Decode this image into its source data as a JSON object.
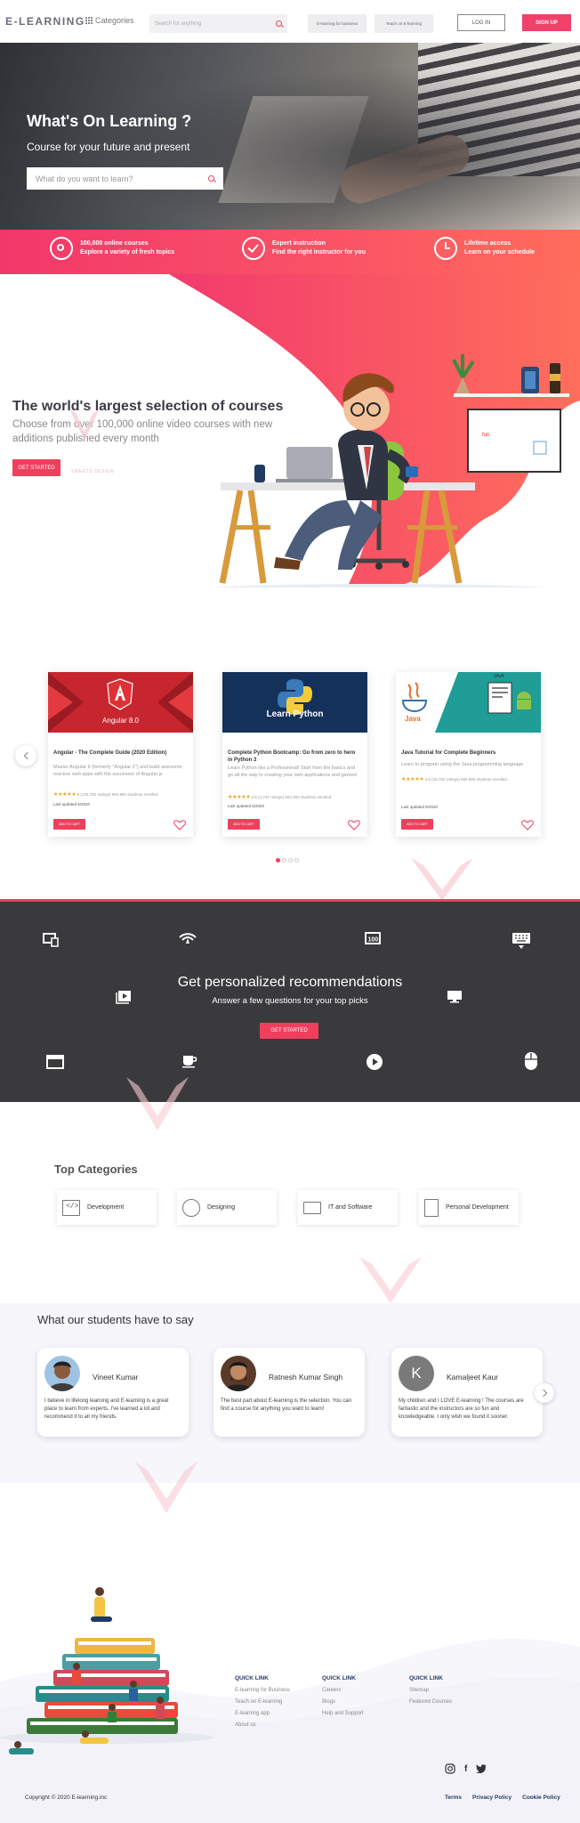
{
  "header": {
    "logo": "E-LEARNING",
    "categories": "Categories",
    "search_placeholder": "Search for anything",
    "pill_business": "E-learning for business",
    "pill_teach": "Teach on E-learning",
    "login": "LOG IN",
    "signup": "SIGN UP"
  },
  "hero": {
    "title": "What's On Learning ?",
    "subtitle": "Course for your future and present",
    "search_placeholder": "What do you want to learn?"
  },
  "features": [
    {
      "title": "100,000 online courses",
      "sub": "Explore a variety of fresh topics",
      "icon": "target-icon"
    },
    {
      "title": "Expert instruction",
      "sub": "Find the right instructor for you",
      "icon": "check-circle-icon"
    },
    {
      "title": "Lifetime access",
      "sub": "Learn on your schedule",
      "icon": "history-icon"
    }
  ],
  "selection": {
    "title": "The world's largest selection of courses",
    "subtitle": "Choose from over 100,000 online video courses with new additions published every month",
    "button": "GET STARTED",
    "watermark": "SWEETS DESIGN"
  },
  "courses": [
    {
      "thumb_label": "Angular 8.0",
      "title": "Angular - The Complete Guide (2020 Edition)",
      "desc": "Master Angular 9 (formerly \"Angular 2\") and build awesome, reactive web apps with the successor of Angular.js",
      "rating": "★★★★★",
      "rating_text": "5 (175,782 ratings) 584,950 students enrolled",
      "updated": "Last updated 5/2020",
      "button": "ADD TO CART"
    },
    {
      "thumb_label": "Learn Python",
      "title": "Complete Python Bootcamp: Go from zero to hero in Python 3",
      "desc": "Learn Python like a Professional! Start from the basics and go all the way to creating your own applications and games!",
      "rating": "★★★★★",
      "rating_text": "4.5 (4,742 ratings) 584,950 students enrolled",
      "updated": "Last updated 5/2020",
      "button": "ADD TO CART"
    },
    {
      "thumb_label": "Java",
      "thumb_label2": "JAVA",
      "title": "Java Tutorial for Complete Beginners",
      "desc": "Learn to program using the Java programming language",
      "rating": "★★★★★",
      "rating_text": "4.5 (18,782 ratings) 584,950 students enrolled",
      "updated": "Last updated 5/2020",
      "button": "ADD TO CART"
    }
  ],
  "recommend": {
    "title": "Get personalized recommendations",
    "subtitle": "Answer a few questions for your top picks",
    "button": "GET STARTED"
  },
  "top_categories": {
    "title": "Top Categories",
    "items": [
      {
        "label": "Development",
        "icon": "code-icon"
      },
      {
        "label": "Designing",
        "icon": "palette-icon"
      },
      {
        "label": "IT and Software",
        "icon": "monitor-icon"
      },
      {
        "label": "Personal Development",
        "icon": "book-icon"
      }
    ]
  },
  "testimonials": {
    "title": "What our students have to say",
    "items": [
      {
        "name": "Vineet Kumar",
        "quote": "I believe in lifelong learning and E-learning is a great place to learn from experts. I've learned a lot and recommend it to all my friends."
      },
      {
        "name": "Ratnesh Kumar Singh",
        "quote": "The best part about E-learning is the selection. You can find a course for anything you want to learn!"
      },
      {
        "name": "Kamaljeet Kaur",
        "initial": "K",
        "quote": "My children and I LOVE E-learning ! The courses are fantastic and the instructors are so fun and knowledgeable. I only wish we found it sooner."
      }
    ]
  },
  "footer": {
    "col1": {
      "head": "QUICK LINK",
      "links": [
        "E-learning for Business",
        "Teach on E-learning",
        "E-learning app",
        "About us"
      ]
    },
    "col2": {
      "head": "QUICK LINK",
      "links": [
        "Careers",
        "Blogs",
        "Help and Support"
      ]
    },
    "col3": {
      "head": "QUICK LINK",
      "links": [
        "Sitemap",
        "Featured Courses"
      ]
    },
    "copyright": "Copyright © 2020 E-learning.inc",
    "terms": "Terms",
    "privacy": "Privacy Policy",
    "cookie": "Cookie Policy",
    "social_facebook": "f"
  },
  "colors": {
    "accent": "#ef3f5d",
    "dark": "#3a3a3c",
    "navy": "#2b3a62"
  }
}
